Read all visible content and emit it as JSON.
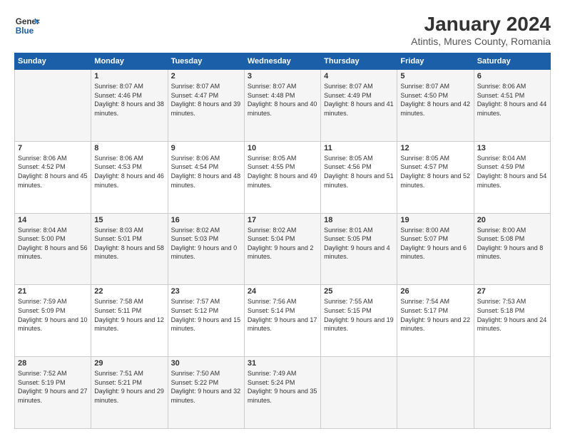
{
  "header": {
    "logo_line1": "General",
    "logo_line2": "Blue",
    "title": "January 2024",
    "subtitle": "Atintis, Mures County, Romania"
  },
  "weekdays": [
    "Sunday",
    "Monday",
    "Tuesday",
    "Wednesday",
    "Thursday",
    "Friday",
    "Saturday"
  ],
  "weeks": [
    [
      {
        "day": "",
        "sunrise": "",
        "sunset": "",
        "daylight": ""
      },
      {
        "day": "1",
        "sunrise": "Sunrise: 8:07 AM",
        "sunset": "Sunset: 4:46 PM",
        "daylight": "Daylight: 8 hours and 38 minutes."
      },
      {
        "day": "2",
        "sunrise": "Sunrise: 8:07 AM",
        "sunset": "Sunset: 4:47 PM",
        "daylight": "Daylight: 8 hours and 39 minutes."
      },
      {
        "day": "3",
        "sunrise": "Sunrise: 8:07 AM",
        "sunset": "Sunset: 4:48 PM",
        "daylight": "Daylight: 8 hours and 40 minutes."
      },
      {
        "day": "4",
        "sunrise": "Sunrise: 8:07 AM",
        "sunset": "Sunset: 4:49 PM",
        "daylight": "Daylight: 8 hours and 41 minutes."
      },
      {
        "day": "5",
        "sunrise": "Sunrise: 8:07 AM",
        "sunset": "Sunset: 4:50 PM",
        "daylight": "Daylight: 8 hours and 42 minutes."
      },
      {
        "day": "6",
        "sunrise": "Sunrise: 8:06 AM",
        "sunset": "Sunset: 4:51 PM",
        "daylight": "Daylight: 8 hours and 44 minutes."
      }
    ],
    [
      {
        "day": "7",
        "sunrise": "Sunrise: 8:06 AM",
        "sunset": "Sunset: 4:52 PM",
        "daylight": "Daylight: 8 hours and 45 minutes."
      },
      {
        "day": "8",
        "sunrise": "Sunrise: 8:06 AM",
        "sunset": "Sunset: 4:53 PM",
        "daylight": "Daylight: 8 hours and 46 minutes."
      },
      {
        "day": "9",
        "sunrise": "Sunrise: 8:06 AM",
        "sunset": "Sunset: 4:54 PM",
        "daylight": "Daylight: 8 hours and 48 minutes."
      },
      {
        "day": "10",
        "sunrise": "Sunrise: 8:05 AM",
        "sunset": "Sunset: 4:55 PM",
        "daylight": "Daylight: 8 hours and 49 minutes."
      },
      {
        "day": "11",
        "sunrise": "Sunrise: 8:05 AM",
        "sunset": "Sunset: 4:56 PM",
        "daylight": "Daylight: 8 hours and 51 minutes."
      },
      {
        "day": "12",
        "sunrise": "Sunrise: 8:05 AM",
        "sunset": "Sunset: 4:57 PM",
        "daylight": "Daylight: 8 hours and 52 minutes."
      },
      {
        "day": "13",
        "sunrise": "Sunrise: 8:04 AM",
        "sunset": "Sunset: 4:59 PM",
        "daylight": "Daylight: 8 hours and 54 minutes."
      }
    ],
    [
      {
        "day": "14",
        "sunrise": "Sunrise: 8:04 AM",
        "sunset": "Sunset: 5:00 PM",
        "daylight": "Daylight: 8 hours and 56 minutes."
      },
      {
        "day": "15",
        "sunrise": "Sunrise: 8:03 AM",
        "sunset": "Sunset: 5:01 PM",
        "daylight": "Daylight: 8 hours and 58 minutes."
      },
      {
        "day": "16",
        "sunrise": "Sunrise: 8:02 AM",
        "sunset": "Sunset: 5:03 PM",
        "daylight": "Daylight: 9 hours and 0 minutes."
      },
      {
        "day": "17",
        "sunrise": "Sunrise: 8:02 AM",
        "sunset": "Sunset: 5:04 PM",
        "daylight": "Daylight: 9 hours and 2 minutes."
      },
      {
        "day": "18",
        "sunrise": "Sunrise: 8:01 AM",
        "sunset": "Sunset: 5:05 PM",
        "daylight": "Daylight: 9 hours and 4 minutes."
      },
      {
        "day": "19",
        "sunrise": "Sunrise: 8:00 AM",
        "sunset": "Sunset: 5:07 PM",
        "daylight": "Daylight: 9 hours and 6 minutes."
      },
      {
        "day": "20",
        "sunrise": "Sunrise: 8:00 AM",
        "sunset": "Sunset: 5:08 PM",
        "daylight": "Daylight: 9 hours and 8 minutes."
      }
    ],
    [
      {
        "day": "21",
        "sunrise": "Sunrise: 7:59 AM",
        "sunset": "Sunset: 5:09 PM",
        "daylight": "Daylight: 9 hours and 10 minutes."
      },
      {
        "day": "22",
        "sunrise": "Sunrise: 7:58 AM",
        "sunset": "Sunset: 5:11 PM",
        "daylight": "Daylight: 9 hours and 12 minutes."
      },
      {
        "day": "23",
        "sunrise": "Sunrise: 7:57 AM",
        "sunset": "Sunset: 5:12 PM",
        "daylight": "Daylight: 9 hours and 15 minutes."
      },
      {
        "day": "24",
        "sunrise": "Sunrise: 7:56 AM",
        "sunset": "Sunset: 5:14 PM",
        "daylight": "Daylight: 9 hours and 17 minutes."
      },
      {
        "day": "25",
        "sunrise": "Sunrise: 7:55 AM",
        "sunset": "Sunset: 5:15 PM",
        "daylight": "Daylight: 9 hours and 19 minutes."
      },
      {
        "day": "26",
        "sunrise": "Sunrise: 7:54 AM",
        "sunset": "Sunset: 5:17 PM",
        "daylight": "Daylight: 9 hours and 22 minutes."
      },
      {
        "day": "27",
        "sunrise": "Sunrise: 7:53 AM",
        "sunset": "Sunset: 5:18 PM",
        "daylight": "Daylight: 9 hours and 24 minutes."
      }
    ],
    [
      {
        "day": "28",
        "sunrise": "Sunrise: 7:52 AM",
        "sunset": "Sunset: 5:19 PM",
        "daylight": "Daylight: 9 hours and 27 minutes."
      },
      {
        "day": "29",
        "sunrise": "Sunrise: 7:51 AM",
        "sunset": "Sunset: 5:21 PM",
        "daylight": "Daylight: 9 hours and 29 minutes."
      },
      {
        "day": "30",
        "sunrise": "Sunrise: 7:50 AM",
        "sunset": "Sunset: 5:22 PM",
        "daylight": "Daylight: 9 hours and 32 minutes."
      },
      {
        "day": "31",
        "sunrise": "Sunrise: 7:49 AM",
        "sunset": "Sunset: 5:24 PM",
        "daylight": "Daylight: 9 hours and 35 minutes."
      },
      {
        "day": "",
        "sunrise": "",
        "sunset": "",
        "daylight": ""
      },
      {
        "day": "",
        "sunrise": "",
        "sunset": "",
        "daylight": ""
      },
      {
        "day": "",
        "sunrise": "",
        "sunset": "",
        "daylight": ""
      }
    ]
  ]
}
